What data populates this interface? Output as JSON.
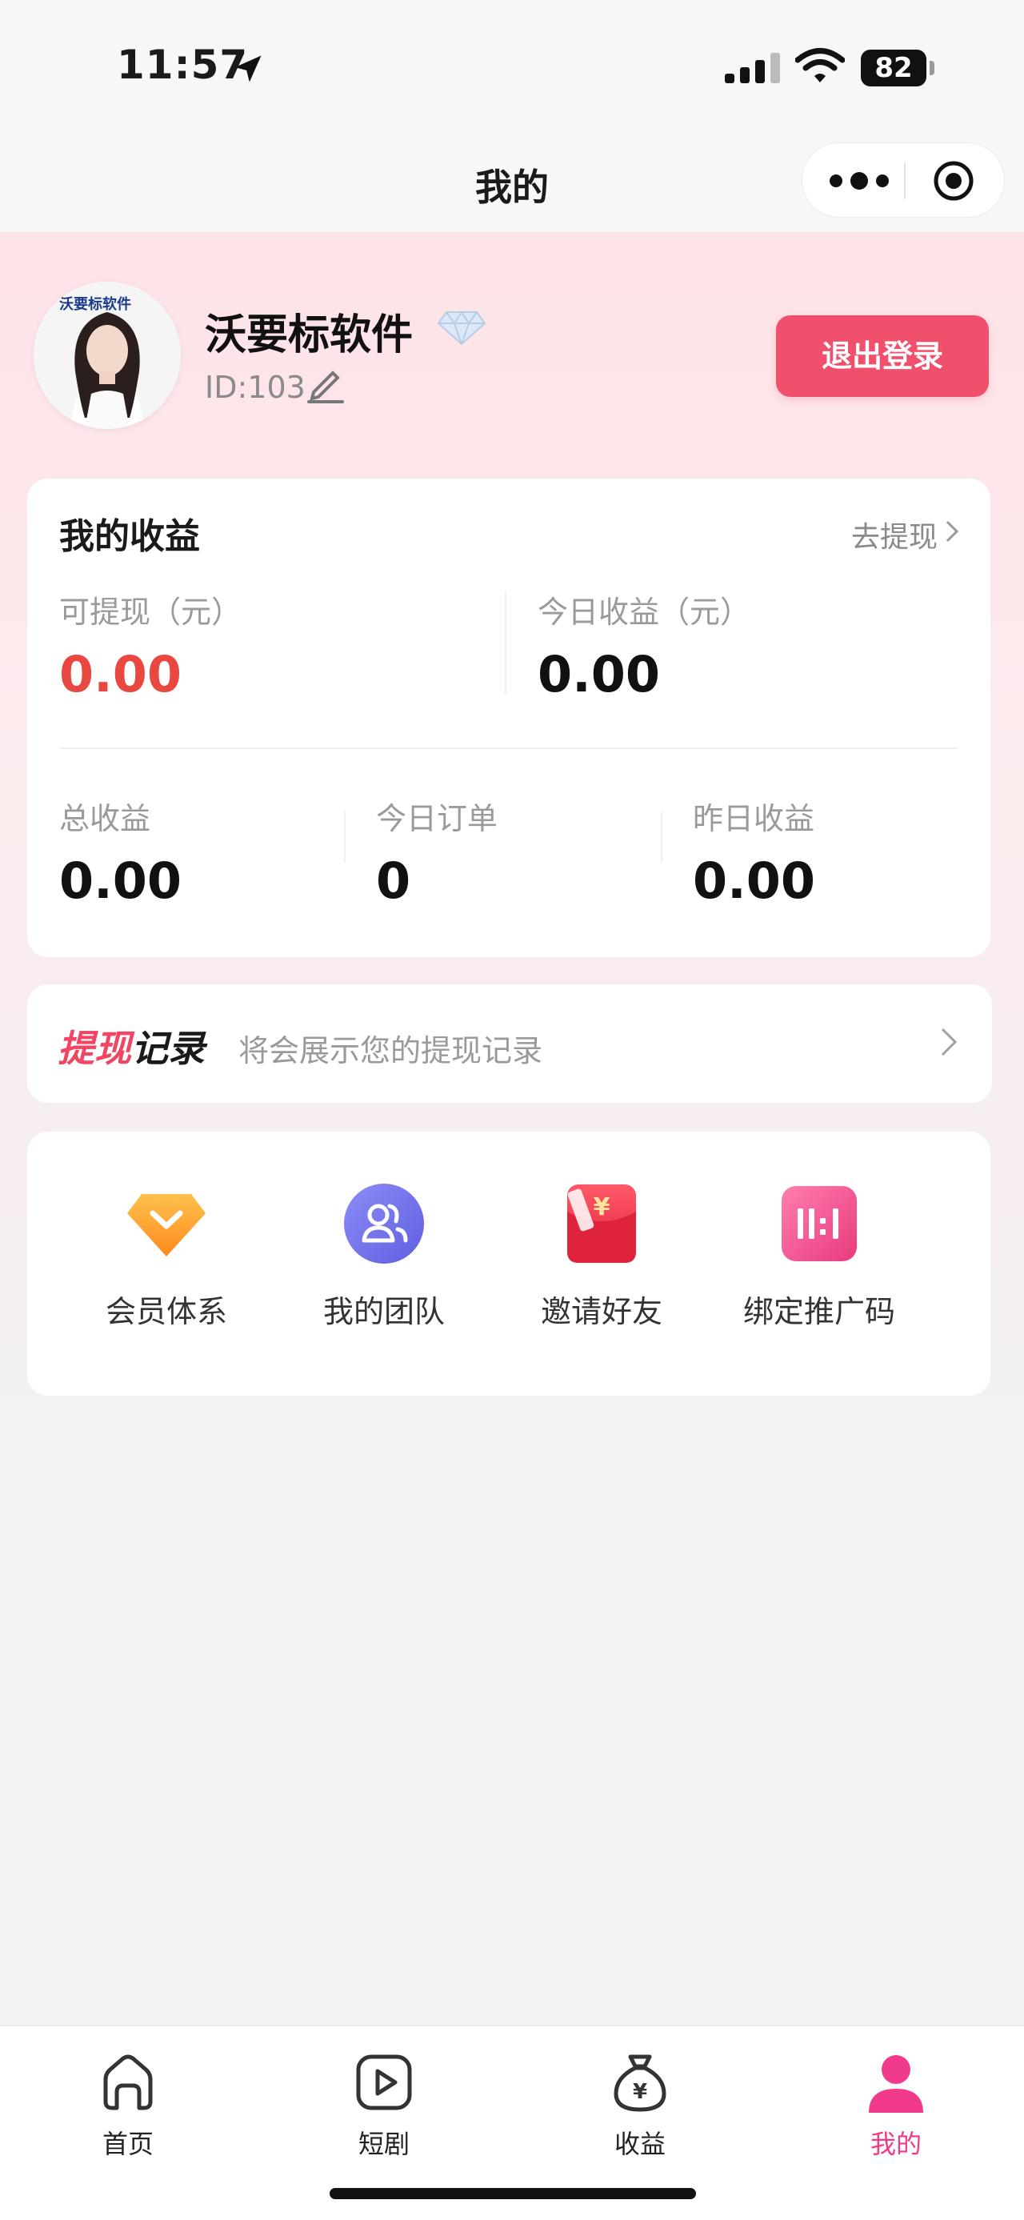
{
  "status_bar": {
    "time": "11:57",
    "battery": "82"
  },
  "nav": {
    "title": "我的"
  },
  "profile": {
    "name": "沃要标软件",
    "id": "ID:103",
    "logout_label": "退出登录",
    "avatar_brand": "沃要标软件"
  },
  "earnings": {
    "title": "我的收益",
    "withdraw_link": "去提现",
    "withdrawable_label": "可提现（元）",
    "withdrawable_value": "0.00",
    "today_income_label": "今日收益（元）",
    "today_income_value": "0.00",
    "total_label": "总收益",
    "total_value": "0.00",
    "today_orders_label": "今日订单",
    "today_orders_value": "0",
    "yesterday_label": "昨日收益",
    "yesterday_value": "0.00"
  },
  "withdraw_record": {
    "title_red": "提现",
    "title_dark": "记录",
    "description": "将会展示您的提现记录"
  },
  "functions": [
    {
      "label": "会员体系",
      "icon": "vip-icon"
    },
    {
      "label": "我的团队",
      "icon": "team-icon"
    },
    {
      "label": "邀请好友",
      "icon": "red-envelope-icon"
    },
    {
      "label": "绑定推广码",
      "icon": "promo-code-icon"
    }
  ],
  "tabs": [
    {
      "label": "首页",
      "icon": "home-icon"
    },
    {
      "label": "短剧",
      "icon": "play-icon"
    },
    {
      "label": "收益",
      "icon": "money-bag-icon"
    },
    {
      "label": "我的",
      "icon": "user-icon",
      "active": true
    }
  ],
  "colors": {
    "accent": "#f1506c",
    "active_tab": "#f23a8a",
    "red_value": "#e8483f"
  }
}
